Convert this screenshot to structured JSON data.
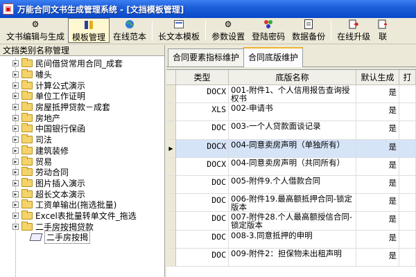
{
  "window": {
    "title": "万能合同文书生成管理系统 - [文挡模板管理]"
  },
  "toolbar": {
    "items": [
      {
        "label": "文书编辑与生成",
        "icon": "gear-icon"
      },
      {
        "label": "模板管理",
        "icon": "template-icon"
      },
      {
        "label": "在线范本",
        "icon": "globe-icon"
      },
      {
        "label": "长文本模板",
        "icon": "card-icon"
      },
      {
        "label": "参数设置",
        "icon": "settings-icon"
      },
      {
        "label": "登陆密码",
        "icon": "password-icon"
      },
      {
        "label": "数据备份",
        "icon": "backup-icon"
      },
      {
        "label": "在线升级",
        "icon": "upgrade-icon"
      },
      {
        "label": "联",
        "icon": "contact-icon"
      }
    ],
    "active_index": 1
  },
  "left_panel": {
    "header": "文挡类别名称管理",
    "tree": [
      {
        "label": "民间借贷常用合同_成套",
        "expanded": false
      },
      {
        "label": "噱头",
        "expanded": false
      },
      {
        "label": "计算公式演示",
        "expanded": false
      },
      {
        "label": "单位工作证明",
        "expanded": false
      },
      {
        "label": "房屋抵押贷款－成套",
        "expanded": false
      },
      {
        "label": "房地产",
        "expanded": false
      },
      {
        "label": "中国银行保函",
        "expanded": false
      },
      {
        "label": "司法",
        "expanded": false
      },
      {
        "label": "建筑装修",
        "expanded": false
      },
      {
        "label": "贸易",
        "expanded": false
      },
      {
        "label": "劳动合同",
        "expanded": false
      },
      {
        "label": "图片插入演示",
        "expanded": false
      },
      {
        "label": "超长文本演示",
        "expanded": false
      },
      {
        "label": "工资单输出(拖选批量)",
        "expanded": false
      },
      {
        "label": "Excel表批量转单文件_拖选",
        "expanded": false
      },
      {
        "label": "二手房按揭贷款",
        "expanded": true
      }
    ],
    "child": {
      "label": "二手房按揭"
    }
  },
  "right_panel": {
    "tabs": [
      {
        "label": "合同要素指标维护"
      },
      {
        "label": "合同底版维护"
      }
    ],
    "active_tab": 1,
    "columns": [
      "类型",
      "底版名称",
      "默认生成",
      "打"
    ],
    "rows": [
      {
        "type": "DOCX",
        "name": "001-附件1、个人信用报告查询授权书",
        "default": "是"
      },
      {
        "type": "XLS",
        "name": "002-申请书",
        "default": "是"
      },
      {
        "type": "DOC",
        "name": "003-一个人贷款面谈记录",
        "default": "是"
      },
      {
        "type": "DOCX",
        "name": "004-同意卖房声明（单独所有）",
        "default": "是"
      },
      {
        "type": "DOCX",
        "name": "004-同意卖房声明（共同所有）",
        "default": "是"
      },
      {
        "type": "DOC",
        "name": "005-附件9.个人借款合同",
        "default": "是"
      },
      {
        "type": "DOC",
        "name": "006-附件19.最高额抵押合同-锁定版本",
        "default": "是"
      },
      {
        "type": "DOC",
        "name": "007-附件28.个人最高额授信合同-锁定版本",
        "default": "是"
      },
      {
        "type": "DOC",
        "name": "008-3.同意抵押的申明",
        "default": "是"
      },
      {
        "type": "DOC",
        "name": "009-附件2：担保物未出租声明",
        "default": "是"
      }
    ],
    "selected_row": 3
  },
  "colors": {
    "title_bar": "#0a48c8",
    "active_tab_accent": "#f0b330",
    "selected_row": "#d6e4f8"
  }
}
